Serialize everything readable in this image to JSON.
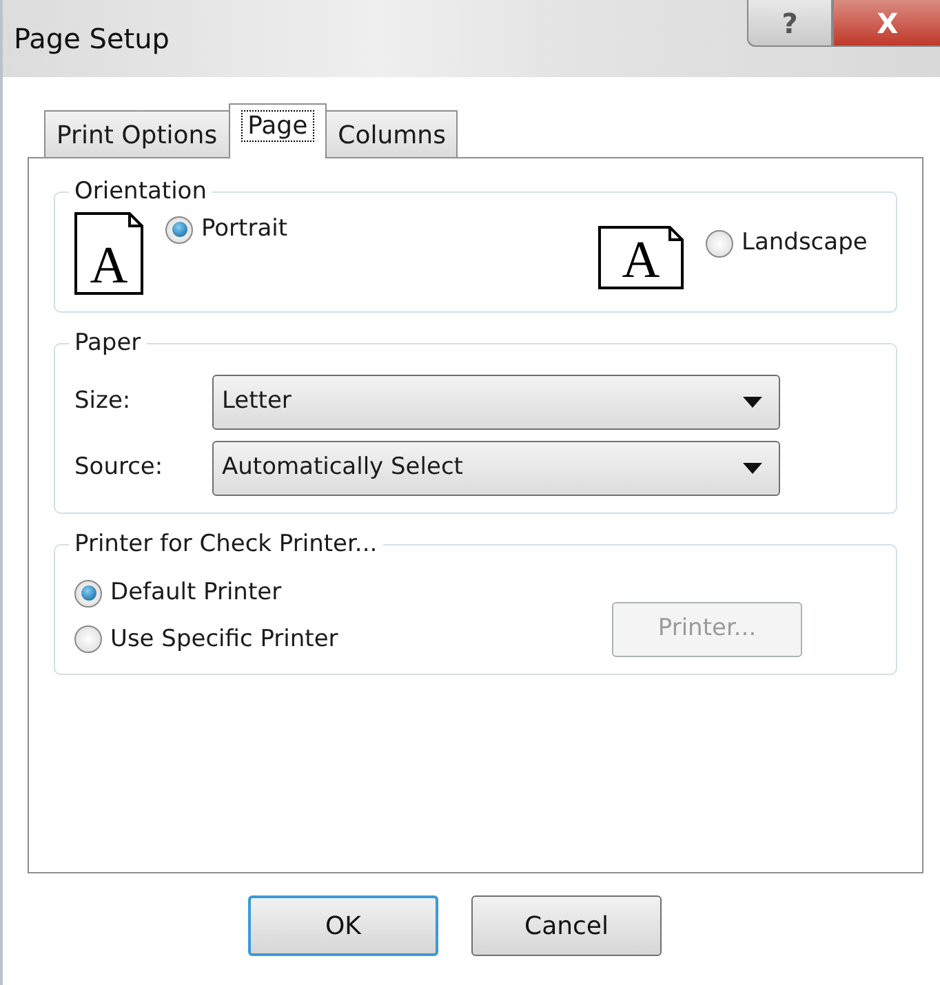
{
  "window": {
    "title": "Page Setup",
    "help_button": "?",
    "close_button": "X"
  },
  "tabs": [
    {
      "label": "Print Options",
      "selected": false
    },
    {
      "label": "Page",
      "selected": true
    },
    {
      "label": "Columns",
      "selected": false
    }
  ],
  "orientation": {
    "title": "Orientation",
    "options": [
      {
        "label": "Portrait",
        "selected": true,
        "icon_letter": "A",
        "kind": "portrait"
      },
      {
        "label": "Landscape",
        "selected": false,
        "icon_letter": "A",
        "kind": "landscape"
      }
    ]
  },
  "paper": {
    "title": "Paper",
    "fields": [
      {
        "label": "Size:",
        "value": "Letter"
      },
      {
        "label": "Source:",
        "value": "Automatically Select"
      }
    ]
  },
  "printer": {
    "title": "Printer for Check Printer...",
    "options": [
      {
        "label": "Default Printer",
        "selected": true
      },
      {
        "label": "Use Specific Printer",
        "selected": false
      }
    ],
    "button": {
      "label": "Printer...",
      "disabled": true
    }
  },
  "buttons": [
    {
      "label": "OK",
      "default": true
    },
    {
      "label": "Cancel",
      "default": false
    }
  ]
}
